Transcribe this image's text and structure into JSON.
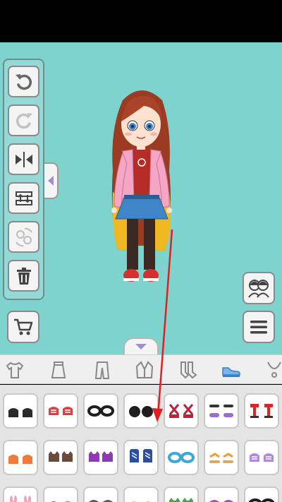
{
  "screen": {
    "stage_color": "#7fd3cf",
    "accent_color": "#7db4e8"
  },
  "toolbar": {
    "buttons": [
      {
        "icon": "undo-icon",
        "enabled": true
      },
      {
        "icon": "redo-icon",
        "enabled": false
      },
      {
        "icon": "flip-icon",
        "enabled": true
      },
      {
        "icon": "layer-swap-icon",
        "enabled": true
      },
      {
        "icon": "reset-character-icon",
        "enabled": false
      },
      {
        "icon": "trash-icon",
        "enabled": true
      }
    ],
    "collapse_icon": "chevron-left-icon"
  },
  "side_buttons": {
    "cart_icon": "cart-icon",
    "couple_icon": "two-characters-icon",
    "menu_icon": "hamburger-menu-icon"
  },
  "drawer": {
    "handle_icon": "chevron-down-icon"
  },
  "categories": [
    {
      "icon": "tshirt-icon",
      "selected": false
    },
    {
      "icon": "skirt-icon",
      "selected": false
    },
    {
      "icon": "pants-icon",
      "selected": false
    },
    {
      "icon": "jacket-icon",
      "selected": false
    },
    {
      "icon": "socks-icon",
      "selected": false
    },
    {
      "icon": "shoes-icon",
      "selected": true
    },
    {
      "icon": "necklace-icon",
      "selected": false
    }
  ],
  "items": [
    {
      "type": "shoes",
      "color": "#2b2b2b"
    },
    {
      "type": "sneakers",
      "color": "#d94040"
    },
    {
      "type": "ring",
      "color": "#1e1e1e"
    },
    {
      "type": "boots",
      "color": "#1e1e1e"
    },
    {
      "type": "strap",
      "color": "#c0203a"
    },
    {
      "type": "slides",
      "color": "#9a6bd1"
    },
    {
      "type": "heels",
      "color": "#d62828"
    },
    {
      "type": "shoes",
      "color": "#f07a3a"
    },
    {
      "type": "cat-shoes",
      "color": "#6b4a3a"
    },
    {
      "type": "cat-shoes",
      "color": "#8d3ab0"
    },
    {
      "type": "hightops",
      "color": "#2a4fa0"
    },
    {
      "type": "ring",
      "color": "#3fa6d8"
    },
    {
      "type": "sandals",
      "color": "#e8a030"
    },
    {
      "type": "sneakers",
      "color": "#b08ae0"
    },
    {
      "type": "bunny",
      "color": "#f3a0b8"
    },
    {
      "type": "shoes",
      "color": "#e84a4a"
    },
    {
      "type": "sneakers",
      "color": "#5a5a5a"
    },
    {
      "type": "shoes",
      "color": "#f2d23a"
    },
    {
      "type": "cat-shoes",
      "color": "#3fa84a"
    },
    {
      "type": "sneakers",
      "color": "#a04ad0"
    },
    {
      "type": "ring",
      "color": "#1e1e1e"
    }
  ]
}
